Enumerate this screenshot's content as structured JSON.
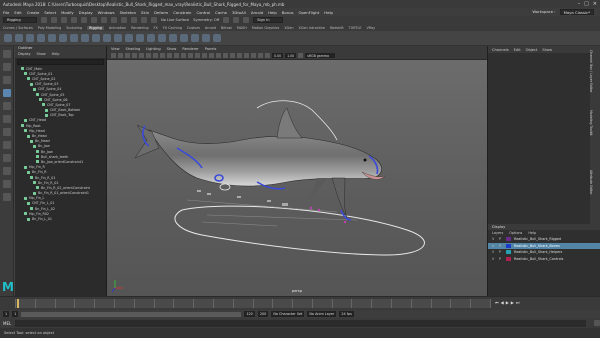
{
  "title": "Autodesk Maya 2018: C:\\Users\\Turbosquid\\Desktop\\Realistic_Bull_Shark_Rigged_max_vray\\Realistic_Bull_Shark_Rigged_for_Maya_mb_ph.mb",
  "menubar": [
    "File",
    "Edit",
    "Create",
    "Select",
    "Modify",
    "Display",
    "Windows",
    "Skeleton",
    "Skin",
    "Deform",
    "Constrain",
    "Control",
    "Cache",
    "3DtoAll",
    "Arnold",
    "Help",
    "Bonus",
    "OpenFlight",
    "Help"
  ],
  "workspace_label": "Workspace :",
  "workspace_value": "Maya Classic*",
  "mode_dropdown": "Rigging",
  "no_live_surface": "No Live Surface",
  "symmetry": "Symmetry: Off",
  "signin": "Sign In",
  "shelf_tabs": [
    "Curves / Surfaces",
    "Poly Modeling",
    "Sculpting",
    "Rigging",
    "Animation",
    "Rendering",
    "FX",
    "FX Caching",
    "Custom",
    "Arnold",
    "Bifrost",
    "MASH",
    "Motion Graphics",
    "XGen",
    "XGen Intractive",
    "Redshift",
    "TURTLE",
    "VRay"
  ],
  "shelf_active": "Rigging",
  "outliner": {
    "title": "Outliner",
    "menu": [
      "Display",
      "Show",
      "Help"
    ],
    "items": [
      {
        "label": "CNT_Main",
        "depth": 1
      },
      {
        "label": "CNT_Spine_01",
        "depth": 2
      },
      {
        "label": "CNT_Spine_02",
        "depth": 3
      },
      {
        "label": "CNT_Spine_03",
        "depth": 4
      },
      {
        "label": "CNT_Spine_04",
        "depth": 5
      },
      {
        "label": "CNT_Spine_05",
        "depth": 6
      },
      {
        "label": "CNT_Spine_06",
        "depth": 7
      },
      {
        "label": "CNT_Spine_07",
        "depth": 8
      },
      {
        "label": "CNT_Back_Bottom",
        "depth": 9
      },
      {
        "label": "CNT_Back_Top",
        "depth": 9
      },
      {
        "label": "CNT_Head",
        "depth": 2
      },
      {
        "label": "Hip_Root",
        "depth": 1
      },
      {
        "label": "Hip_Head",
        "depth": 2
      },
      {
        "label": "Bn_Head",
        "depth": 3
      },
      {
        "label": "Bn_Head",
        "depth": 4
      },
      {
        "label": "Bn_Jaw",
        "depth": 5
      },
      {
        "label": "Bn_Jaw",
        "depth": 6
      },
      {
        "label": "Bull_shark_teeth",
        "depth": 6
      },
      {
        "label": "Bn_Jaw_orientConstraint1",
        "depth": 6
      },
      {
        "label": "Hip_Fin_R",
        "depth": 2
      },
      {
        "label": "Bn_Fin_R",
        "depth": 3
      },
      {
        "label": "Bn_Fin_R_01",
        "depth": 4
      },
      {
        "label": "Bn_Fin_R_02",
        "depth": 5
      },
      {
        "label": "Bn_Fin_R_02_orientConstraint",
        "depth": 6
      },
      {
        "label": "Bn_Fin_R_01_orientConstraint1",
        "depth": 5
      },
      {
        "label": "Hip_Fin_L",
        "depth": 2
      },
      {
        "label": "CNT_Fin_L_01",
        "depth": 3
      },
      {
        "label": "Bn_Fin_L_02",
        "depth": 4
      },
      {
        "label": "Hip_Fin_R02",
        "depth": 2
      },
      {
        "label": "Bn_Fin_L_01",
        "depth": 3
      }
    ]
  },
  "viewport": {
    "menu": [
      "View",
      "Shading",
      "Lighting",
      "Show",
      "Renderer",
      "Panels"
    ],
    "field_value_1": "0.00",
    "field_value_2": "1.00",
    "colorspace": "sRGB gamma",
    "camera_label": "persp"
  },
  "channel_box": {
    "menu": [
      "Channels",
      "Edit",
      "Object",
      "Show"
    ]
  },
  "side_tabs": [
    "Channel Box / Layer Editor",
    "Modeling Toolkit",
    "Attribute Editor"
  ],
  "layers": {
    "title": "Display",
    "tabs": [
      "Display",
      "Anim"
    ],
    "menu": [
      "Layers",
      "Options",
      "Help"
    ],
    "rows": [
      {
        "v": "V",
        "p": "P",
        "label": "Realistic_Bull_Shark_Rigged",
        "color": "#6a2a8a",
        "selected": false
      },
      {
        "v": "V",
        "p": "P",
        "label": "Realistic_Bull_Shark_Bones",
        "color": "#1a3ac8",
        "selected": true
      },
      {
        "v": "V",
        "p": "P",
        "label": "Realistic_Bull_Shark_Helpers",
        "color": "#28a0b0",
        "selected": false
      },
      {
        "v": "V",
        "p": "P",
        "label": "Realistic_Bull_Shark_Controls",
        "color": "#b02050",
        "selected": false
      }
    ]
  },
  "timeline": {
    "start": "1",
    "end": "120",
    "range_start": "1",
    "range_end": "120",
    "playback_end": "200",
    "current": "1",
    "no_char_set": "No Character Set",
    "no_anim_layer": "No Anim Layer",
    "fps": "24 fps"
  },
  "command_line": {
    "label": "MEL"
  },
  "help_line": "Select Tool: select an object"
}
